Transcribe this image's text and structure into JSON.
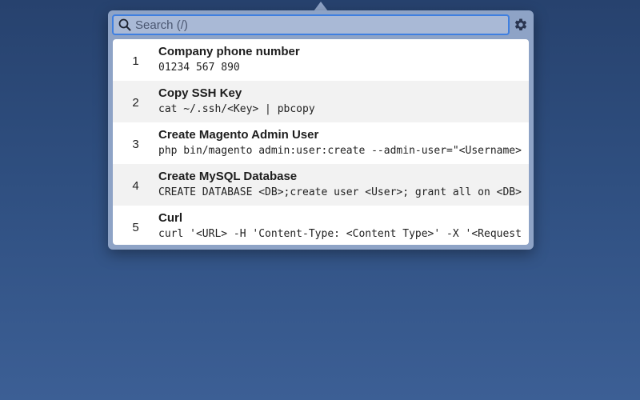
{
  "search": {
    "placeholder": "Search (/)",
    "value": ""
  },
  "settings_icon": "gear-icon",
  "snippets": [
    {
      "index": "1",
      "title": "Company phone number",
      "command": "01234 567 890"
    },
    {
      "index": "2",
      "title": "Copy SSH Key",
      "command": "cat ~/.ssh/<Key> | pbcopy"
    },
    {
      "index": "3",
      "title": "Create Magento Admin User",
      "command": "php bin/magento admin:user:create --admin-user=\"<Username>"
    },
    {
      "index": "4",
      "title": "Create MySQL Database",
      "command": "CREATE DATABASE <DB>;create user <User>; grant all on <DB>"
    },
    {
      "index": "5",
      "title": "Curl",
      "command": "curl '<URL> -H 'Content-Type: <Content Type>' -X '<Request"
    }
  ],
  "colors": {
    "desktop": "#2f4f80",
    "popover": "#8ea3c6",
    "search_focus": "#3f7fe0",
    "row_alt": "#f2f2f2"
  }
}
